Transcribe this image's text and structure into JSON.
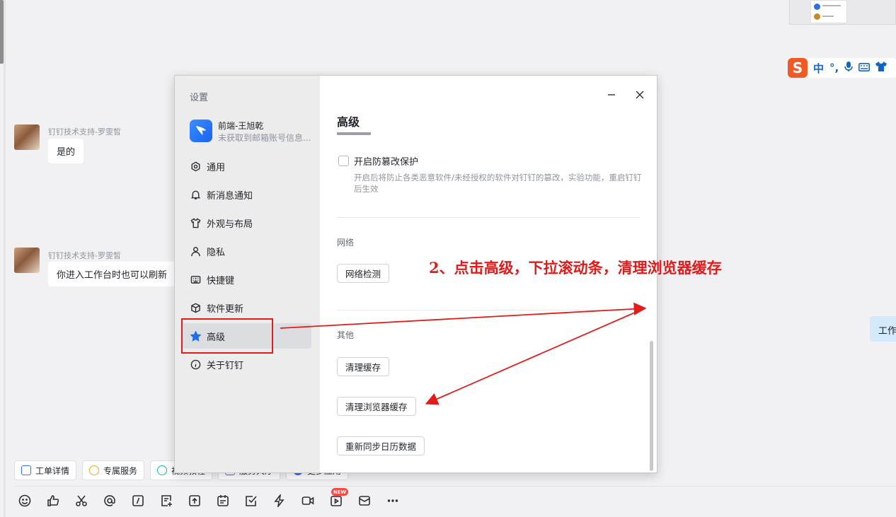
{
  "chat": {
    "messages": [
      {
        "sender": "钉钉技术支持-罗雯皙",
        "text": "是的"
      },
      {
        "sender": "钉钉技术支持-罗雯皙",
        "text": "你进入工作台时也可以刷新"
      }
    ],
    "right_bubble": "工作"
  },
  "ime": {
    "logo": "S",
    "items": [
      "中",
      "°,",
      "🎤",
      "⌨",
      "👕"
    ]
  },
  "quick_actions": [
    "工单详情",
    "专属服务",
    "视频教程",
    "服务大厅",
    "更多应用"
  ],
  "toolbar": {
    "icons": [
      "emoji-icon",
      "thumbs-up-icon",
      "scissors-icon",
      "at-icon",
      "slash-command-icon",
      "doc-add-icon",
      "upload-file-icon",
      "calendar-icon",
      "todo-check-icon",
      "lightning-icon",
      "video-call-icon",
      "live-play-icon",
      "mail-icon",
      "more-icon"
    ],
    "new_badge": "NEW"
  },
  "settings": {
    "title": "设置",
    "profile": {
      "name": "前端-王旭乾",
      "subtitle": "未获取到邮箱账号信息..."
    },
    "nav": [
      {
        "label": "通用",
        "icon": "settings-icon"
      },
      {
        "label": "新消息通知",
        "icon": "bell-icon"
      },
      {
        "label": "外观与布局",
        "icon": "shirt-icon"
      },
      {
        "label": "隐私",
        "icon": "person-icon"
      },
      {
        "label": "快捷键",
        "icon": "keyboard-icon"
      },
      {
        "label": "软件更新",
        "icon": "cube-icon"
      },
      {
        "label": "高级",
        "icon": "star-icon",
        "active": true
      },
      {
        "label": "关于钉钉",
        "icon": "info-icon"
      }
    ],
    "section_title": "高级",
    "tamper": {
      "label": "开启防篡改保护",
      "checked": false,
      "description": "开启后将防止各类恶意软件/未经授权的软件对钉钉的篡改，实验功能，重启钉钉后生效"
    },
    "network": {
      "label": "网络",
      "button": "网络检测"
    },
    "other": {
      "label": "其他",
      "buttons": [
        "清理缓存",
        "清理浏览器缓存",
        "重新同步日历数据"
      ]
    }
  },
  "annotation": {
    "text": "2、点击高级，下拉滚动条，清理浏览器缓存",
    "color": "#e01b1b"
  },
  "colors": {
    "accent": "#3370ff",
    "annotation": "#e21b1b",
    "sidebar_bg": "#ececed"
  }
}
